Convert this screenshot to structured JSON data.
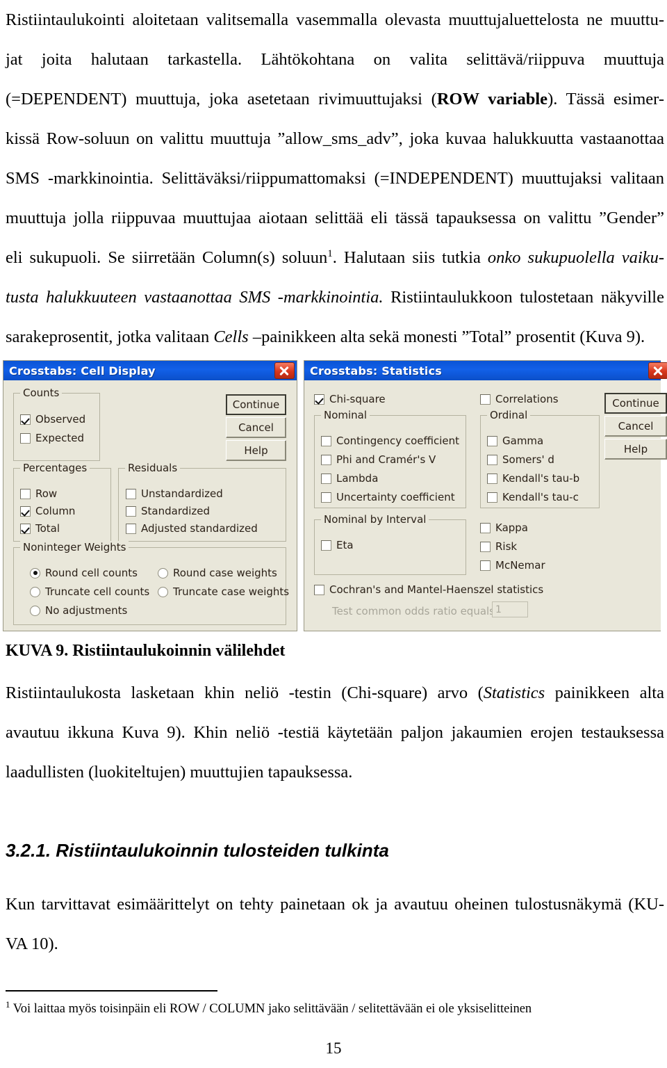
{
  "document": {
    "page_number": "15",
    "paragraphs": [
      {
        "id": "p1",
        "lines": [
          "Ristiintaulukointi aloitetaan valitsemalla vasemmalla olevasta muuttujaluettelosta ne muuttu-",
          "jat joita halutaan tarkastella. Lähtökohtana on valita selittävä/riippuva muuttuja"
        ]
      }
    ],
    "line1": "Ristiintaulukointi aloitetaan valitsemalla vasemmalla olevasta muuttujaluettelosta ne muuttu-",
    "line2a": "jat  joita  halutaan  tarkastella.  Lähtökohtana  on  valita  selittävä/riippuva  muuttuja",
    "line3a": "(=DEPENDENT) muuttuja, joka asetetaan rivimuuttujaksi (",
    "line3b": "ROW variable",
    "line3c": "). Tässä esimer-",
    "line4": "kissä Row-soluun on valittu muuttuja ”allow_sms_adv”, joka kuvaa halukkuutta vastaanottaa",
    "line5": "SMS -markkinointia. Selittäväksi/riippumattomaksi (=INDEPENDENT) muuttujaksi valitaan",
    "line6": "muuttuja jolla riippuvaa muuttujaa aiotaan selittää eli tässä tapauksessa on valittu ”Gender”",
    "line7a": "eli sukupuoli. Se siirretään Column(s) soluun",
    "line7_footnote_marker": "1",
    "line7b": ". Halutaan siis tutkia ",
    "line7c": "onko sukupuolella vaiku-",
    "line8a": "tusta halukkuuteen vastaanottaa SMS -markkinointia.",
    "line8b": " Ristiintaulukkoon tulostetaan näkyville",
    "line9a": "sarakeprosentit, jotka valitaan ",
    "line9b": "Cells",
    "line9c": " –painikkeen alta sekä monesti ”Total” prosentit (Kuva 9).",
    "caption": "KUVA 9. Ristiintaulukoinnin välilehdet",
    "line10a": "Ristiintaulukosta lasketaan khin neliö -testin (Chi-square) arvo (",
    "line10b": "Statistics",
    "line10c": " painikkeen alta",
    "line11": "avautuu ikkuna Kuva 9). Khin neliö -testiä käytetään paljon jakaumien erojen testauksessa",
    "line12": "laadullisten (luokiteltujen) muuttujien tapauksessa.",
    "subheading": "3.2.1. Ristiintaulukoinnin tulosteiden tulkinta",
    "line13": "Kun tarvittavat esimäärittelyt on tehty painetaan ok ja avautuu oheinen tulostusnäkymä (KU-",
    "line14": "VA 10).",
    "footnote_marker": "1",
    "footnote_text": "Voi laittaa myös toisinpäin eli ROW / COLUMN jako selittävään / selitettävään ei ole yksiselitteinen"
  },
  "cell_display_dialog": {
    "title": "Crosstabs: Cell Display",
    "close_label": "×",
    "buttons": {
      "continue": "Continue",
      "cancel": "Cancel",
      "help": "Help"
    },
    "groups": {
      "counts": {
        "label": "Counts",
        "items": [
          {
            "label": "Observed",
            "checked": true
          },
          {
            "label": "Expected",
            "checked": false
          }
        ]
      },
      "percentages": {
        "label": "Percentages",
        "items": [
          {
            "label": "Row",
            "checked": false
          },
          {
            "label": "Column",
            "checked": true
          },
          {
            "label": "Total",
            "checked": true
          }
        ]
      },
      "residuals": {
        "label": "Residuals",
        "items": [
          {
            "label": "Unstandardized",
            "checked": false
          },
          {
            "label": "Standardized",
            "checked": false
          },
          {
            "label": "Adjusted standardized",
            "checked": false
          }
        ]
      },
      "noninteger_weights": {
        "label": "Noninteger Weights",
        "items_left": [
          {
            "label": "Round cell counts",
            "checked": true
          },
          {
            "label": "Truncate cell counts",
            "checked": false
          },
          {
            "label": "No adjustments",
            "checked": false
          }
        ],
        "items_right": [
          {
            "label": "Round case weights",
            "checked": false
          },
          {
            "label": "Truncate case weights",
            "checked": false
          }
        ]
      }
    }
  },
  "statistics_dialog": {
    "title": "Crosstabs: Statistics",
    "buttons": {
      "continue": "Continue",
      "cancel": "Cancel",
      "help": "Help"
    },
    "chi_square": {
      "label": "Chi-square",
      "checked": true
    },
    "correlations": {
      "label": "Correlations",
      "checked": false
    },
    "groups": {
      "nominal": {
        "label": "Nominal",
        "items": [
          {
            "label": "Contingency coefficient",
            "checked": false
          },
          {
            "label": "Phi and Cramér's V",
            "checked": false
          },
          {
            "label": "Lambda",
            "checked": false
          },
          {
            "label": "Uncertainty coefficient",
            "checked": false
          }
        ]
      },
      "ordinal": {
        "label": "Ordinal",
        "items": [
          {
            "label": "Gamma",
            "checked": false
          },
          {
            "label": "Somers' d",
            "checked": false
          },
          {
            "label": "Kendall's tau-b",
            "checked": false
          },
          {
            "label": "Kendall's tau-c",
            "checked": false
          }
        ]
      },
      "nominal_by_interval": {
        "label": "Nominal by Interval",
        "items": [
          {
            "label": "Eta",
            "checked": false
          }
        ]
      }
    },
    "standalone": [
      {
        "label": "Kappa",
        "checked": false
      },
      {
        "label": "Risk",
        "checked": false
      },
      {
        "label": "McNemar",
        "checked": false
      }
    ],
    "cochran": {
      "label": "Cochran's and Mantel-Haenszel statistics",
      "checked": false
    },
    "odds_ratio": {
      "label": "Test common odds ratio equals:",
      "value": "1"
    }
  },
  "colors": {
    "titlebar": "#0B56D7",
    "dialog_bg": "#E9E7DA",
    "close_button": "#D8361C",
    "text": "#2b2118"
  }
}
